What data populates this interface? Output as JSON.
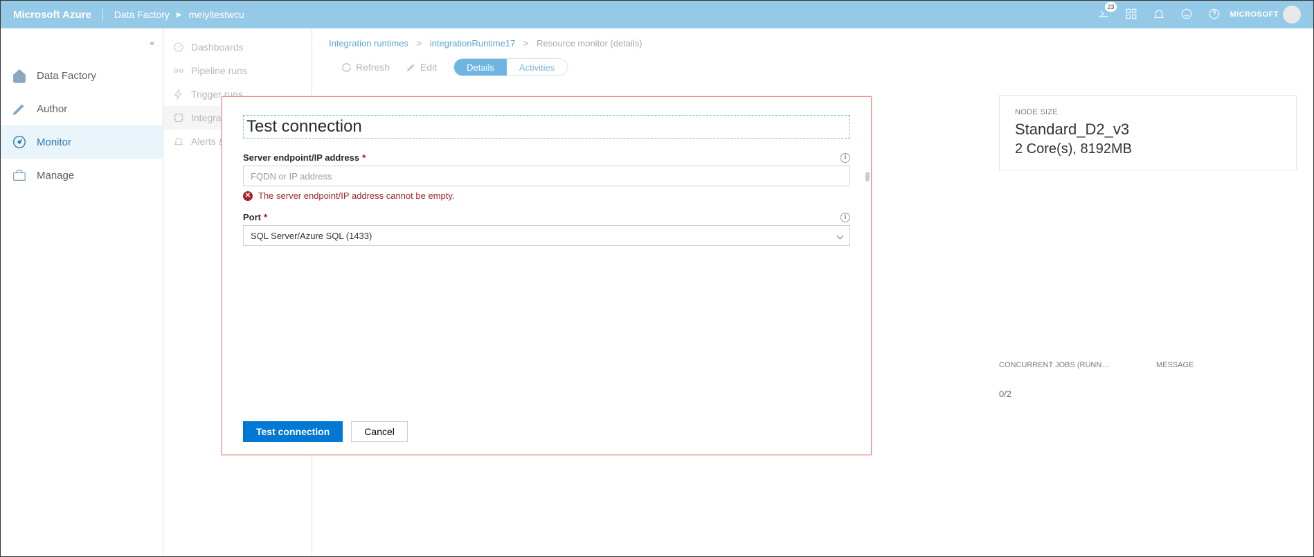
{
  "topbar": {
    "brand": "Microsoft Azure",
    "service": "Data Factory",
    "instance": "meiyltestwcu",
    "notif_count": "23",
    "org": "MICROSOFT"
  },
  "nav1": {
    "items": [
      {
        "label": "Data Factory"
      },
      {
        "label": "Author"
      },
      {
        "label": "Monitor"
      },
      {
        "label": "Manage"
      }
    ]
  },
  "nav2": {
    "items": [
      {
        "label": "Dashboards"
      },
      {
        "label": "Pipeline runs"
      },
      {
        "label": "Trigger runs"
      },
      {
        "label": "Integration ru"
      },
      {
        "label": "Alerts & m"
      }
    ]
  },
  "crumbs": {
    "a": "Integration runtimes",
    "b": "integrationRuntime17",
    "c": "Resource monitor (details)"
  },
  "actions": {
    "refresh": "Refresh",
    "edit": "Edit",
    "details": "Details",
    "activities": "Activities"
  },
  "card": {
    "label": "NODE SIZE",
    "value1": "Standard_D2_v3",
    "value2": "2 Core(s), 8192MB"
  },
  "cols": {
    "c1": "CONCURRENT JOBS (RUNN…",
    "c1v": "0/2",
    "c2": "MESSAGE"
  },
  "modal": {
    "title": "Test connection",
    "f1_label": "Server endpoint/IP address",
    "f1_placeholder": "FQDN or IP address",
    "f1_error": "The server endpoint/IP address cannot be empty.",
    "f2_label": "Port",
    "f2_value": "SQL Server/Azure SQL (1433)",
    "btn_primary": "Test connection",
    "btn_cancel": "Cancel"
  }
}
